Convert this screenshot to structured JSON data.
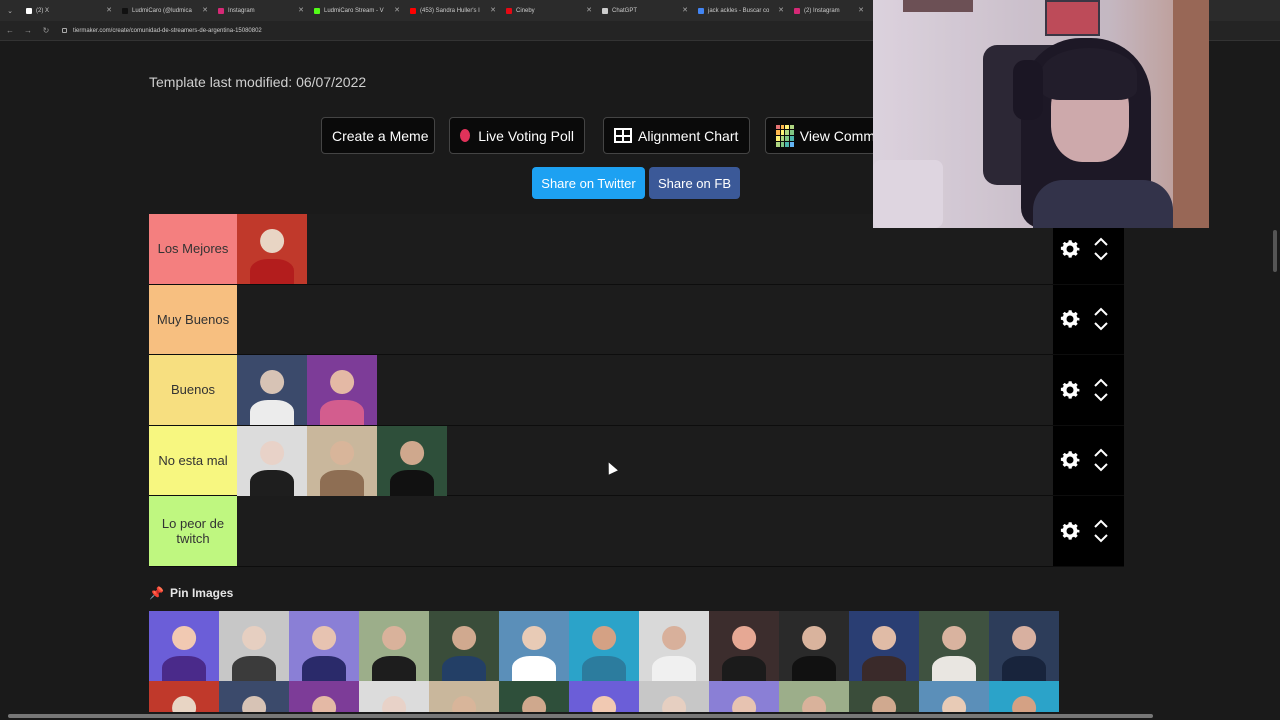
{
  "browser": {
    "tabs": [
      {
        "label": "(2) X",
        "color": "#ffffff"
      },
      {
        "label": "LudmiCaro (@ludmica",
        "color": "#111111"
      },
      {
        "label": "Instagram",
        "color": "#d62976"
      },
      {
        "label": "LudmiCaro Stream - V",
        "color": "#53fc18"
      },
      {
        "label": "(453) Sandra Huller's I",
        "color": "#ff0000"
      },
      {
        "label": "Cineby",
        "color": "#e50914"
      },
      {
        "label": "ChatGPT",
        "color": "#cccccc"
      },
      {
        "label": "jack ackles - Buscar co",
        "color": "#4285f4"
      },
      {
        "label": "(2) Instagram",
        "color": "#d62976"
      }
    ],
    "url": "tiermaker.com/create/comunidad-de-streamers-de-argentina-15080802"
  },
  "page": {
    "last_modified": "Template last modified: 06/07/2022",
    "buttons": {
      "create_meme": "Create a Meme",
      "live_poll": "Live Voting Poll",
      "alignment": "Alignment Chart",
      "view_comm": "View Comm"
    },
    "share": {
      "twitter": "Share on Twitter",
      "fb": "Share on FB"
    },
    "pin_images": "Pin Images"
  },
  "tiers": [
    {
      "label": "Los Mejores",
      "color": "#f47f7f",
      "items": 1
    },
    {
      "label": "Muy Buenos",
      "color": "#f7bf80",
      "items": 0
    },
    {
      "label": "Buenos",
      "color": "#f7df80",
      "items": 2
    },
    {
      "label": "No esta mal",
      "color": "#f7f780",
      "items": 3
    },
    {
      "label": "Lo peor de twitch",
      "color": "#bff780",
      "items": 0
    }
  ],
  "colors": {
    "twitter": "#1da1f2",
    "facebook": "#3b5998",
    "control_bg": "#000000",
    "page_bg": "#1a1a1a"
  }
}
